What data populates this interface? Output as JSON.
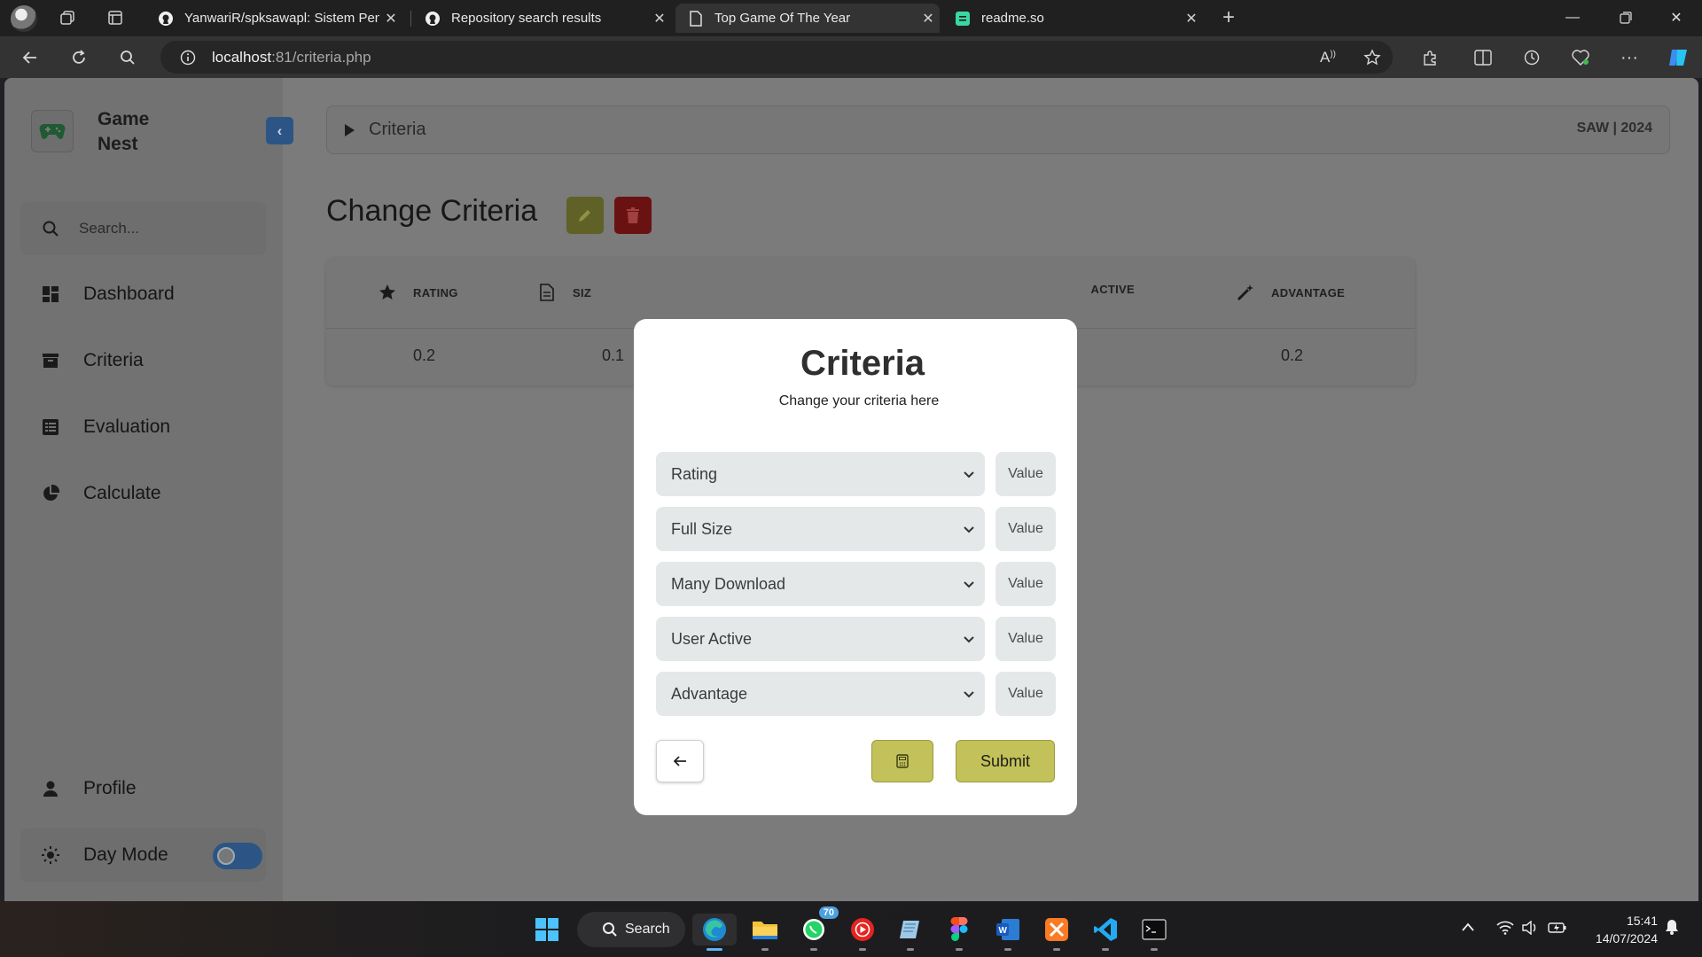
{
  "browser": {
    "tabs": [
      {
        "title": "YanwariR/spksawapl: Sistem Pend",
        "icon": "github-icon"
      },
      {
        "title": "Repository search results",
        "icon": "github-icon"
      },
      {
        "title": "Top Game Of The Year",
        "icon": "page-icon"
      },
      {
        "title": "readme.so",
        "icon": "readme-icon"
      }
    ],
    "active_tab": 2,
    "url_host": "localhost",
    "url_path": ":81/criteria.php"
  },
  "sidebar": {
    "app_name": "Game Nest",
    "search_placeholder": "Search...",
    "items": [
      {
        "label": "Dashboard",
        "icon": "dashboard-icon"
      },
      {
        "label": "Criteria",
        "icon": "archive-icon"
      },
      {
        "label": "Evaluation",
        "icon": "list-icon"
      },
      {
        "label": "Calculate",
        "icon": "pie-chart-icon"
      }
    ],
    "profile_label": "Profile",
    "day_mode_label": "Day Mode"
  },
  "header": {
    "breadcrumb": "Criteria",
    "right_text": "SAW | 2024"
  },
  "main": {
    "title": "Change Criteria",
    "table": {
      "columns": [
        "RATING",
        "SIZE",
        "ACTIVE",
        "ADVANTAGE"
      ],
      "values": [
        "0.2",
        "0.1",
        "0.2"
      ]
    }
  },
  "modal": {
    "title": "Criteria",
    "subtitle": "Change your criteria here",
    "rows": [
      {
        "select": "Rating",
        "value_placeholder": "Value"
      },
      {
        "select": "Full Size",
        "value_placeholder": "Value"
      },
      {
        "select": "Many Download",
        "value_placeholder": "Value"
      },
      {
        "select": "User Active",
        "value_placeholder": "Value"
      },
      {
        "select": "Advantage",
        "value_placeholder": "Value"
      }
    ],
    "submit_label": "Submit"
  },
  "taskbar": {
    "search_label": "Search",
    "whatsapp_badge": "70",
    "time": "15:41",
    "date": "14/07/2024"
  },
  "colors": {
    "accent_olive": "#c3c25a",
    "danger": "#6a1212",
    "toggle_blue": "#2c5585"
  }
}
